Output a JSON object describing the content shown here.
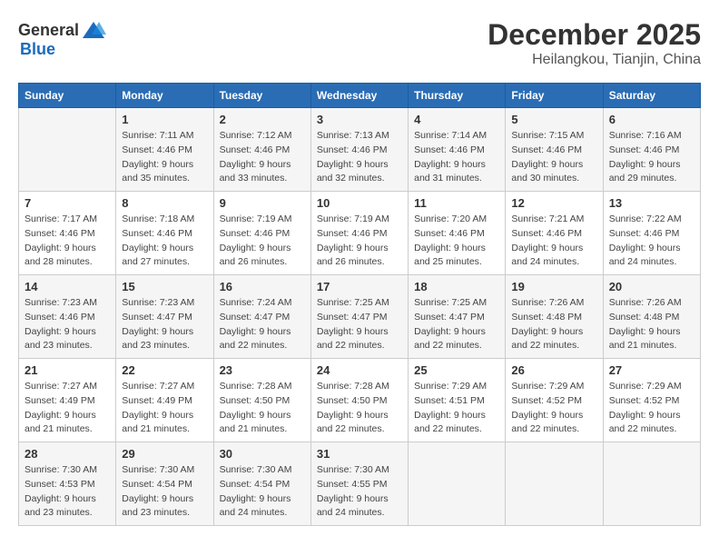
{
  "header": {
    "logo_general": "General",
    "logo_blue": "Blue",
    "title": "December 2025",
    "subtitle": "Heilangkou, Tianjin, China"
  },
  "days_of_week": [
    "Sunday",
    "Monday",
    "Tuesday",
    "Wednesday",
    "Thursday",
    "Friday",
    "Saturday"
  ],
  "weeks": [
    [
      {
        "day": "",
        "info": ""
      },
      {
        "day": "1",
        "info": "Sunrise: 7:11 AM\nSunset: 4:46 PM\nDaylight: 9 hours\nand 35 minutes."
      },
      {
        "day": "2",
        "info": "Sunrise: 7:12 AM\nSunset: 4:46 PM\nDaylight: 9 hours\nand 33 minutes."
      },
      {
        "day": "3",
        "info": "Sunrise: 7:13 AM\nSunset: 4:46 PM\nDaylight: 9 hours\nand 32 minutes."
      },
      {
        "day": "4",
        "info": "Sunrise: 7:14 AM\nSunset: 4:46 PM\nDaylight: 9 hours\nand 31 minutes."
      },
      {
        "day": "5",
        "info": "Sunrise: 7:15 AM\nSunset: 4:46 PM\nDaylight: 9 hours\nand 30 minutes."
      },
      {
        "day": "6",
        "info": "Sunrise: 7:16 AM\nSunset: 4:46 PM\nDaylight: 9 hours\nand 29 minutes."
      }
    ],
    [
      {
        "day": "7",
        "info": "Sunrise: 7:17 AM\nSunset: 4:46 PM\nDaylight: 9 hours\nand 28 minutes."
      },
      {
        "day": "8",
        "info": "Sunrise: 7:18 AM\nSunset: 4:46 PM\nDaylight: 9 hours\nand 27 minutes."
      },
      {
        "day": "9",
        "info": "Sunrise: 7:19 AM\nSunset: 4:46 PM\nDaylight: 9 hours\nand 26 minutes."
      },
      {
        "day": "10",
        "info": "Sunrise: 7:19 AM\nSunset: 4:46 PM\nDaylight: 9 hours\nand 26 minutes."
      },
      {
        "day": "11",
        "info": "Sunrise: 7:20 AM\nSunset: 4:46 PM\nDaylight: 9 hours\nand 25 minutes."
      },
      {
        "day": "12",
        "info": "Sunrise: 7:21 AM\nSunset: 4:46 PM\nDaylight: 9 hours\nand 24 minutes."
      },
      {
        "day": "13",
        "info": "Sunrise: 7:22 AM\nSunset: 4:46 PM\nDaylight: 9 hours\nand 24 minutes."
      }
    ],
    [
      {
        "day": "14",
        "info": "Sunrise: 7:23 AM\nSunset: 4:46 PM\nDaylight: 9 hours\nand 23 minutes."
      },
      {
        "day": "15",
        "info": "Sunrise: 7:23 AM\nSunset: 4:47 PM\nDaylight: 9 hours\nand 23 minutes."
      },
      {
        "day": "16",
        "info": "Sunrise: 7:24 AM\nSunset: 4:47 PM\nDaylight: 9 hours\nand 22 minutes."
      },
      {
        "day": "17",
        "info": "Sunrise: 7:25 AM\nSunset: 4:47 PM\nDaylight: 9 hours\nand 22 minutes."
      },
      {
        "day": "18",
        "info": "Sunrise: 7:25 AM\nSunset: 4:47 PM\nDaylight: 9 hours\nand 22 minutes."
      },
      {
        "day": "19",
        "info": "Sunrise: 7:26 AM\nSunset: 4:48 PM\nDaylight: 9 hours\nand 22 minutes."
      },
      {
        "day": "20",
        "info": "Sunrise: 7:26 AM\nSunset: 4:48 PM\nDaylight: 9 hours\nand 21 minutes."
      }
    ],
    [
      {
        "day": "21",
        "info": "Sunrise: 7:27 AM\nSunset: 4:49 PM\nDaylight: 9 hours\nand 21 minutes."
      },
      {
        "day": "22",
        "info": "Sunrise: 7:27 AM\nSunset: 4:49 PM\nDaylight: 9 hours\nand 21 minutes."
      },
      {
        "day": "23",
        "info": "Sunrise: 7:28 AM\nSunset: 4:50 PM\nDaylight: 9 hours\nand 21 minutes."
      },
      {
        "day": "24",
        "info": "Sunrise: 7:28 AM\nSunset: 4:50 PM\nDaylight: 9 hours\nand 22 minutes."
      },
      {
        "day": "25",
        "info": "Sunrise: 7:29 AM\nSunset: 4:51 PM\nDaylight: 9 hours\nand 22 minutes."
      },
      {
        "day": "26",
        "info": "Sunrise: 7:29 AM\nSunset: 4:52 PM\nDaylight: 9 hours\nand 22 minutes."
      },
      {
        "day": "27",
        "info": "Sunrise: 7:29 AM\nSunset: 4:52 PM\nDaylight: 9 hours\nand 22 minutes."
      }
    ],
    [
      {
        "day": "28",
        "info": "Sunrise: 7:30 AM\nSunset: 4:53 PM\nDaylight: 9 hours\nand 23 minutes."
      },
      {
        "day": "29",
        "info": "Sunrise: 7:30 AM\nSunset: 4:54 PM\nDaylight: 9 hours\nand 23 minutes."
      },
      {
        "day": "30",
        "info": "Sunrise: 7:30 AM\nSunset: 4:54 PM\nDaylight: 9 hours\nand 24 minutes."
      },
      {
        "day": "31",
        "info": "Sunrise: 7:30 AM\nSunset: 4:55 PM\nDaylight: 9 hours\nand 24 minutes."
      },
      {
        "day": "",
        "info": ""
      },
      {
        "day": "",
        "info": ""
      },
      {
        "day": "",
        "info": ""
      }
    ]
  ]
}
